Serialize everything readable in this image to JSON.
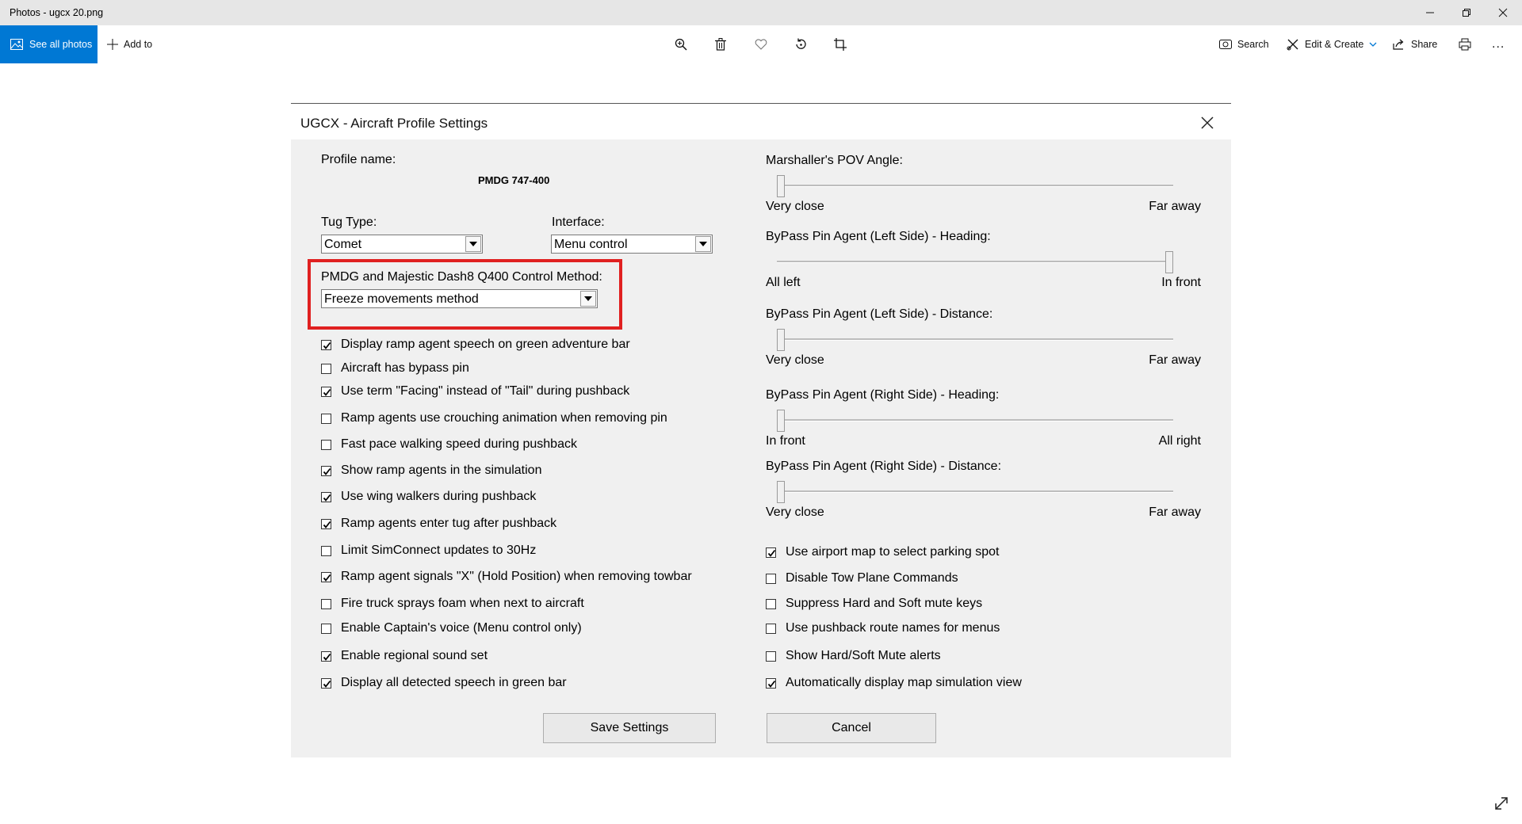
{
  "window": {
    "title": "Photos - ugcx 20.png"
  },
  "toolbar": {
    "see_all": "See all photos",
    "add_to": "Add to",
    "search": "Search",
    "edit_create": "Edit & Create",
    "share": "Share",
    "more": "..."
  },
  "dialog": {
    "title": "UGCX - Aircraft Profile Settings",
    "profile_label": "Profile name:",
    "profile_value": "PMDG 747-400",
    "tug_label": "Tug Type:",
    "tug_value": "Comet",
    "interface_label": "Interface:",
    "interface_value": "Menu control",
    "method_label": "PMDG and Majestic Dash8 Q400 Control Method:",
    "method_value": "Freeze movements method",
    "left_checks": [
      {
        "label": "Display ramp agent speech on green adventure bar",
        "checked": true
      },
      {
        "label": "Aircraft has bypass pin",
        "checked": false
      },
      {
        "label": "Use term \"Facing\" instead of \"Tail\" during pushback",
        "checked": true
      },
      {
        "label": "Ramp agents use crouching animation when removing pin",
        "checked": false
      },
      {
        "label": "Fast pace walking speed during pushback",
        "checked": false
      },
      {
        "label": "Show ramp agents in the simulation",
        "checked": true
      },
      {
        "label": "Use wing walkers during pushback",
        "checked": true
      },
      {
        "label": "Ramp agents enter tug after pushback",
        "checked": true
      },
      {
        "label": "Limit SimConnect updates to 30Hz",
        "checked": false
      },
      {
        "label": "Ramp agent signals \"X\" (Hold Position) when removing towbar",
        "checked": true
      },
      {
        "label": "Fire truck sprays foam when next to aircraft",
        "checked": false
      },
      {
        "label": "Enable Captain's voice (Menu control only)",
        "checked": false
      },
      {
        "label": "Enable regional sound set",
        "checked": true
      },
      {
        "label": "Display all detected speech in green bar",
        "checked": true
      }
    ],
    "sliders": [
      {
        "label": "Marshaller's POV Angle:",
        "min_label": "Very close",
        "max_label": "Far away",
        "value": 0
      },
      {
        "label": "ByPass Pin Agent (Left Side) - Heading:",
        "min_label": "All left",
        "max_label": "In front",
        "value": 1
      },
      {
        "label": "ByPass Pin Agent (Left Side) - Distance:",
        "min_label": "Very close",
        "max_label": "Far away",
        "value": 0
      },
      {
        "label": "ByPass Pin Agent (Right Side) - Heading:",
        "min_label": "In front",
        "max_label": "All right",
        "value": 0
      },
      {
        "label": "ByPass Pin Agent (Right Side) - Distance:",
        "min_label": "Very close",
        "max_label": "Far away",
        "value": 0
      }
    ],
    "right_checks": [
      {
        "label": "Use airport map to select parking spot",
        "checked": true
      },
      {
        "label": "Disable Tow Plane Commands",
        "checked": false
      },
      {
        "label": "Suppress Hard and Soft mute keys",
        "checked": false
      },
      {
        "label": "Use pushback route names for menus",
        "checked": false
      },
      {
        "label": "Show Hard/Soft Mute alerts",
        "checked": false
      },
      {
        "label": "Automatically display map simulation view",
        "checked": true
      }
    ],
    "save_label": "Save Settings",
    "cancel_label": "Cancel"
  },
  "colors": {
    "accent": "#0078d4",
    "highlight_box": "#e02020",
    "dialog_bg": "#f0f0f0"
  }
}
